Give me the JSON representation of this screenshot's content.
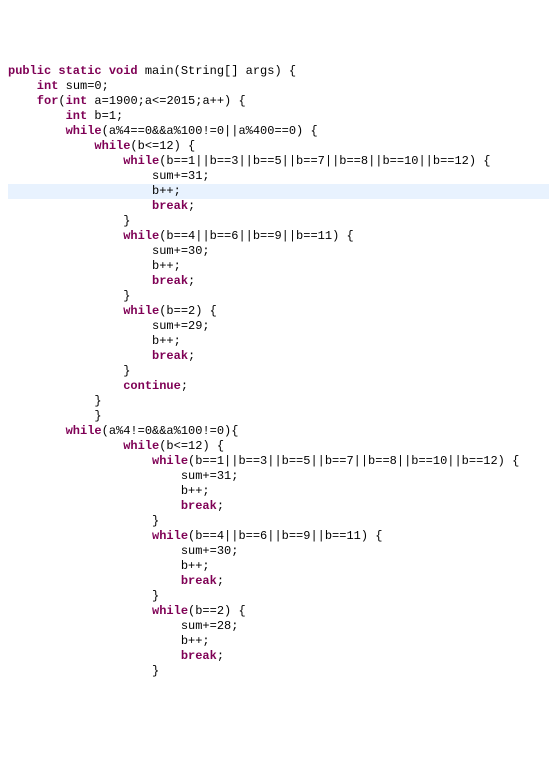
{
  "code": {
    "highlight_index": 8,
    "lines": [
      [
        [
          "kw",
          "public static void"
        ],
        [
          "plain",
          " main(String[] args) {"
        ]
      ],
      [
        [
          "kw",
          "    int"
        ],
        [
          "plain",
          " sum=0;"
        ]
      ],
      [
        [
          "kw",
          "    for"
        ],
        [
          "plain",
          "("
        ],
        [
          "kw",
          "int"
        ],
        [
          "plain",
          " a=1900;a<=2015;a++) {"
        ]
      ],
      [
        [
          "kw",
          "        int"
        ],
        [
          "plain",
          " b=1;"
        ]
      ],
      [
        [
          "kw",
          "        while"
        ],
        [
          "plain",
          "(a%4==0&&a%100!=0||a%400==0) {"
        ]
      ],
      [
        [
          "kw",
          "            while"
        ],
        [
          "plain",
          "(b<=12) {"
        ]
      ],
      [
        [
          "kw",
          "                while"
        ],
        [
          "plain",
          "(b==1||b==3||b==5||b==7||b==8||b==10||b==12) {"
        ]
      ],
      [
        [
          "plain",
          "                    sum+=31;"
        ]
      ],
      [
        [
          "plain",
          "                    b++;"
        ]
      ],
      [
        [
          "kw",
          "                    break"
        ],
        [
          "plain",
          ";"
        ]
      ],
      [
        [
          "plain",
          "                }"
        ]
      ],
      [
        [
          "kw",
          "                while"
        ],
        [
          "plain",
          "(b==4||b==6||b==9||b==11) {"
        ]
      ],
      [
        [
          "plain",
          "                    sum+=30;"
        ]
      ],
      [
        [
          "plain",
          "                    b++;"
        ]
      ],
      [
        [
          "kw",
          "                    break"
        ],
        [
          "plain",
          ";"
        ]
      ],
      [
        [
          "plain",
          "                }"
        ]
      ],
      [
        [
          "kw",
          "                while"
        ],
        [
          "plain",
          "(b==2) {"
        ]
      ],
      [
        [
          "plain",
          "                    sum+=29;"
        ]
      ],
      [
        [
          "plain",
          "                    b++;"
        ]
      ],
      [
        [
          "kw",
          "                    break"
        ],
        [
          "plain",
          ";"
        ]
      ],
      [
        [
          "plain",
          "                }"
        ]
      ],
      [
        [
          "kw",
          "                continue"
        ],
        [
          "plain",
          ";"
        ]
      ],
      [
        [
          "plain",
          "            }"
        ]
      ],
      [
        [
          "plain",
          "            }"
        ]
      ],
      [
        [
          "kw",
          "        while"
        ],
        [
          "plain",
          "(a%4!=0&&a%100!=0){"
        ]
      ],
      [
        [
          "kw",
          "                while"
        ],
        [
          "plain",
          "(b<=12) {"
        ]
      ],
      [
        [
          "kw",
          "                    while"
        ],
        [
          "plain",
          "(b==1||b==3||b==5||b==7||b==8||b==10||b==12) {"
        ]
      ],
      [
        [
          "plain",
          "                        sum+=31;"
        ]
      ],
      [
        [
          "plain",
          "                        b++;"
        ]
      ],
      [
        [
          "kw",
          "                        break"
        ],
        [
          "plain",
          ";"
        ]
      ],
      [
        [
          "plain",
          "                    }"
        ]
      ],
      [
        [
          "kw",
          "                    while"
        ],
        [
          "plain",
          "(b==4||b==6||b==9||b==11) {"
        ]
      ],
      [
        [
          "plain",
          "                        sum+=30;"
        ]
      ],
      [
        [
          "plain",
          "                        b++;"
        ]
      ],
      [
        [
          "kw",
          "                        break"
        ],
        [
          "plain",
          ";"
        ]
      ],
      [
        [
          "plain",
          "                    }"
        ]
      ],
      [
        [
          "kw",
          "                    while"
        ],
        [
          "plain",
          "(b==2) {"
        ]
      ],
      [
        [
          "plain",
          "                        sum+=28;"
        ]
      ],
      [
        [
          "plain",
          "                        b++;"
        ]
      ],
      [
        [
          "kw",
          "                        break"
        ],
        [
          "plain",
          ";"
        ]
      ],
      [
        [
          "plain",
          "                    }"
        ]
      ]
    ]
  }
}
